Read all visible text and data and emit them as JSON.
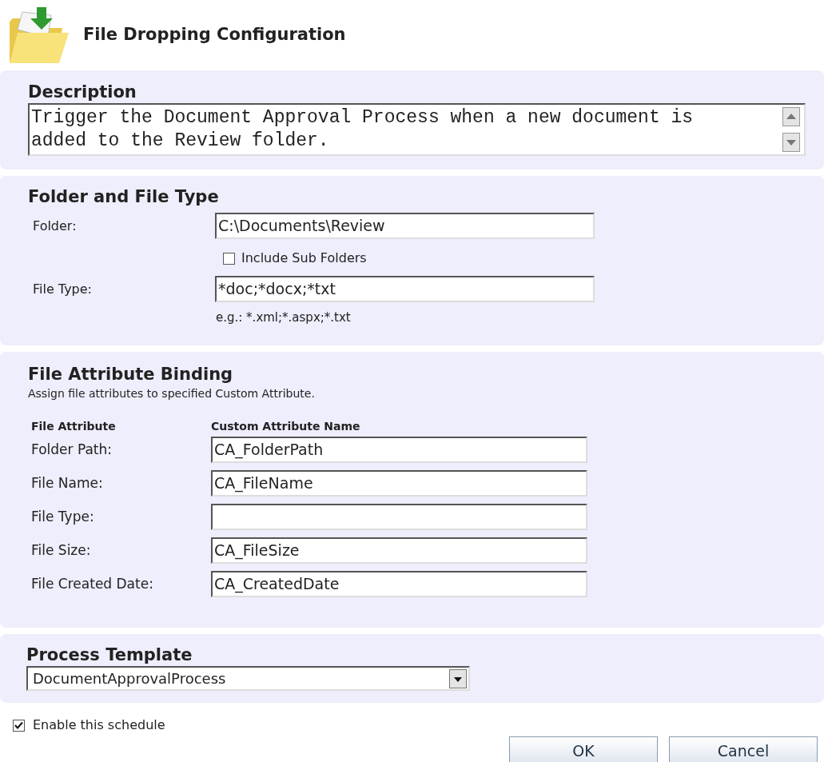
{
  "title": "File Dropping Configuration",
  "description": {
    "heading": "Description",
    "value": "Trigger the Document Approval Process when a new document is added to the Review folder."
  },
  "folder_section": {
    "heading": "Folder and File Type",
    "folder": {
      "label": "Folder:",
      "value": "C:\\Documents\\Review"
    },
    "include_sub_folders": {
      "label": "Include Sub Folders",
      "checked": false
    },
    "file_type": {
      "label": "File Type:",
      "value": "*doc;*docx;*txt"
    },
    "hint": "e.g.: *.xml;*.aspx;*.txt"
  },
  "binding": {
    "heading": "File Attribute Binding",
    "subtitle": "Assign file attributes to specified Custom Attribute.",
    "columns": [
      "File Attribute",
      "Custom Attribute Name"
    ],
    "rows": [
      {
        "label": "Folder Path:",
        "value": "CA_FolderPath"
      },
      {
        "label": "File Name:",
        "value": "CA_FileName"
      },
      {
        "label": "File Type:",
        "value": ""
      },
      {
        "label": "File Size:",
        "value": "CA_FileSize"
      },
      {
        "label": "File Created Date:",
        "value": "CA_CreatedDate"
      }
    ]
  },
  "process_template": {
    "heading": "Process Template",
    "value": "DocumentApprovalProcess"
  },
  "enable_schedule": {
    "label": "Enable this schedule",
    "checked": true
  },
  "buttons": [
    "OK",
    "Cancel"
  ]
}
